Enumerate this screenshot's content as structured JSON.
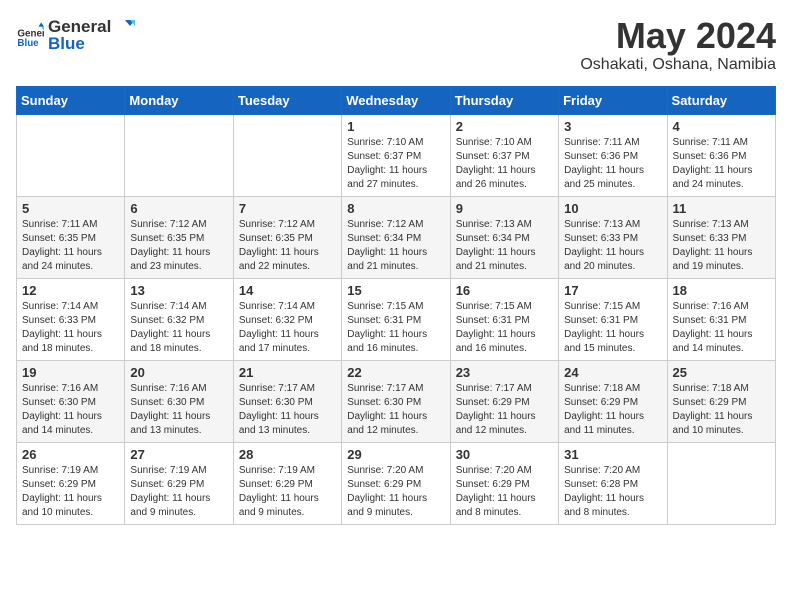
{
  "header": {
    "logo_general": "General",
    "logo_blue": "Blue",
    "title": "May 2024",
    "location": "Oshakati, Oshana, Namibia"
  },
  "weekdays": [
    "Sunday",
    "Monday",
    "Tuesday",
    "Wednesday",
    "Thursday",
    "Friday",
    "Saturday"
  ],
  "weeks": [
    [
      {
        "day": "",
        "info": ""
      },
      {
        "day": "",
        "info": ""
      },
      {
        "day": "",
        "info": ""
      },
      {
        "day": "1",
        "info": "Sunrise: 7:10 AM\nSunset: 6:37 PM\nDaylight: 11 hours and 27 minutes."
      },
      {
        "day": "2",
        "info": "Sunrise: 7:10 AM\nSunset: 6:37 PM\nDaylight: 11 hours and 26 minutes."
      },
      {
        "day": "3",
        "info": "Sunrise: 7:11 AM\nSunset: 6:36 PM\nDaylight: 11 hours and 25 minutes."
      },
      {
        "day": "4",
        "info": "Sunrise: 7:11 AM\nSunset: 6:36 PM\nDaylight: 11 hours and 24 minutes."
      }
    ],
    [
      {
        "day": "5",
        "info": "Sunrise: 7:11 AM\nSunset: 6:35 PM\nDaylight: 11 hours and 24 minutes."
      },
      {
        "day": "6",
        "info": "Sunrise: 7:12 AM\nSunset: 6:35 PM\nDaylight: 11 hours and 23 minutes."
      },
      {
        "day": "7",
        "info": "Sunrise: 7:12 AM\nSunset: 6:35 PM\nDaylight: 11 hours and 22 minutes."
      },
      {
        "day": "8",
        "info": "Sunrise: 7:12 AM\nSunset: 6:34 PM\nDaylight: 11 hours and 21 minutes."
      },
      {
        "day": "9",
        "info": "Sunrise: 7:13 AM\nSunset: 6:34 PM\nDaylight: 11 hours and 21 minutes."
      },
      {
        "day": "10",
        "info": "Sunrise: 7:13 AM\nSunset: 6:33 PM\nDaylight: 11 hours and 20 minutes."
      },
      {
        "day": "11",
        "info": "Sunrise: 7:13 AM\nSunset: 6:33 PM\nDaylight: 11 hours and 19 minutes."
      }
    ],
    [
      {
        "day": "12",
        "info": "Sunrise: 7:14 AM\nSunset: 6:33 PM\nDaylight: 11 hours and 18 minutes."
      },
      {
        "day": "13",
        "info": "Sunrise: 7:14 AM\nSunset: 6:32 PM\nDaylight: 11 hours and 18 minutes."
      },
      {
        "day": "14",
        "info": "Sunrise: 7:14 AM\nSunset: 6:32 PM\nDaylight: 11 hours and 17 minutes."
      },
      {
        "day": "15",
        "info": "Sunrise: 7:15 AM\nSunset: 6:31 PM\nDaylight: 11 hours and 16 minutes."
      },
      {
        "day": "16",
        "info": "Sunrise: 7:15 AM\nSunset: 6:31 PM\nDaylight: 11 hours and 16 minutes."
      },
      {
        "day": "17",
        "info": "Sunrise: 7:15 AM\nSunset: 6:31 PM\nDaylight: 11 hours and 15 minutes."
      },
      {
        "day": "18",
        "info": "Sunrise: 7:16 AM\nSunset: 6:31 PM\nDaylight: 11 hours and 14 minutes."
      }
    ],
    [
      {
        "day": "19",
        "info": "Sunrise: 7:16 AM\nSunset: 6:30 PM\nDaylight: 11 hours and 14 minutes."
      },
      {
        "day": "20",
        "info": "Sunrise: 7:16 AM\nSunset: 6:30 PM\nDaylight: 11 hours and 13 minutes."
      },
      {
        "day": "21",
        "info": "Sunrise: 7:17 AM\nSunset: 6:30 PM\nDaylight: 11 hours and 13 minutes."
      },
      {
        "day": "22",
        "info": "Sunrise: 7:17 AM\nSunset: 6:30 PM\nDaylight: 11 hours and 12 minutes."
      },
      {
        "day": "23",
        "info": "Sunrise: 7:17 AM\nSunset: 6:29 PM\nDaylight: 11 hours and 12 minutes."
      },
      {
        "day": "24",
        "info": "Sunrise: 7:18 AM\nSunset: 6:29 PM\nDaylight: 11 hours and 11 minutes."
      },
      {
        "day": "25",
        "info": "Sunrise: 7:18 AM\nSunset: 6:29 PM\nDaylight: 11 hours and 10 minutes."
      }
    ],
    [
      {
        "day": "26",
        "info": "Sunrise: 7:19 AM\nSunset: 6:29 PM\nDaylight: 11 hours and 10 minutes."
      },
      {
        "day": "27",
        "info": "Sunrise: 7:19 AM\nSunset: 6:29 PM\nDaylight: 11 hours and 9 minutes."
      },
      {
        "day": "28",
        "info": "Sunrise: 7:19 AM\nSunset: 6:29 PM\nDaylight: 11 hours and 9 minutes."
      },
      {
        "day": "29",
        "info": "Sunrise: 7:20 AM\nSunset: 6:29 PM\nDaylight: 11 hours and 9 minutes."
      },
      {
        "day": "30",
        "info": "Sunrise: 7:20 AM\nSunset: 6:29 PM\nDaylight: 11 hours and 8 minutes."
      },
      {
        "day": "31",
        "info": "Sunrise: 7:20 AM\nSunset: 6:28 PM\nDaylight: 11 hours and 8 minutes."
      },
      {
        "day": "",
        "info": ""
      }
    ]
  ]
}
